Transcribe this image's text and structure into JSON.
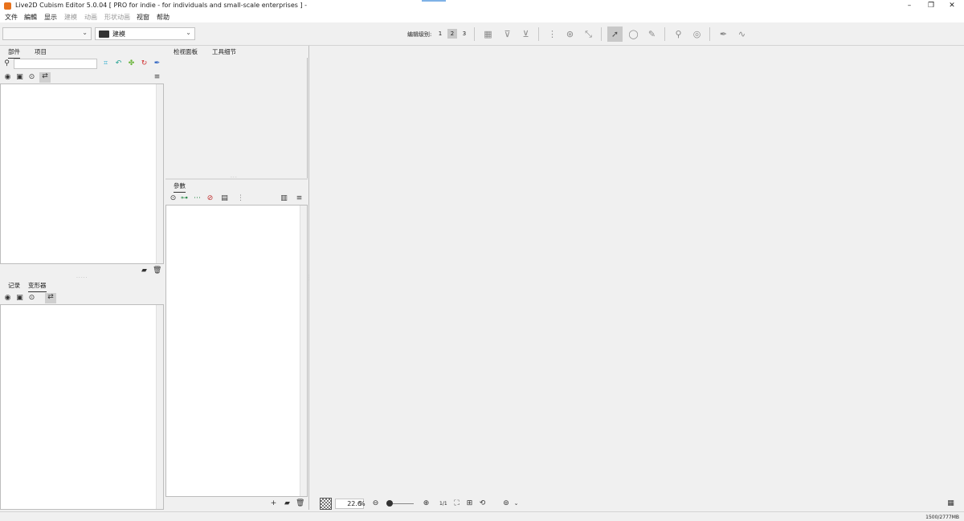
{
  "window": {
    "title": "Live2D Cubism Editor 5.0.04   [ PRO for indie - for individuals and small-scale enterprises ]  -",
    "minimize": "–",
    "restore": "❐",
    "close": "✕"
  },
  "menu": [
    "文件",
    "編輯",
    "显示",
    "建模",
    "动画",
    "形状动画",
    "视窗",
    "帮助"
  ],
  "toolbar": {
    "mode_label": "建模",
    "edit_level_label": "编辑级别:",
    "levels": [
      "1",
      "2",
      "3"
    ],
    "selected_level": "2"
  },
  "parts_panel": {
    "tabs": [
      "部件",
      "项目"
    ]
  },
  "inspector_panel": {
    "tabs": [
      "检视面板",
      "工具细节"
    ]
  },
  "params_panel": {
    "tabs": [
      "參數"
    ]
  },
  "deformer_panel": {
    "tabs": [
      "记录",
      "变形器"
    ]
  },
  "viewport": {
    "zoom_value": "22.6",
    "zoom_unit": "%",
    "ratio_label": "1/1"
  },
  "status": {
    "memory": "1500/2777MB"
  }
}
